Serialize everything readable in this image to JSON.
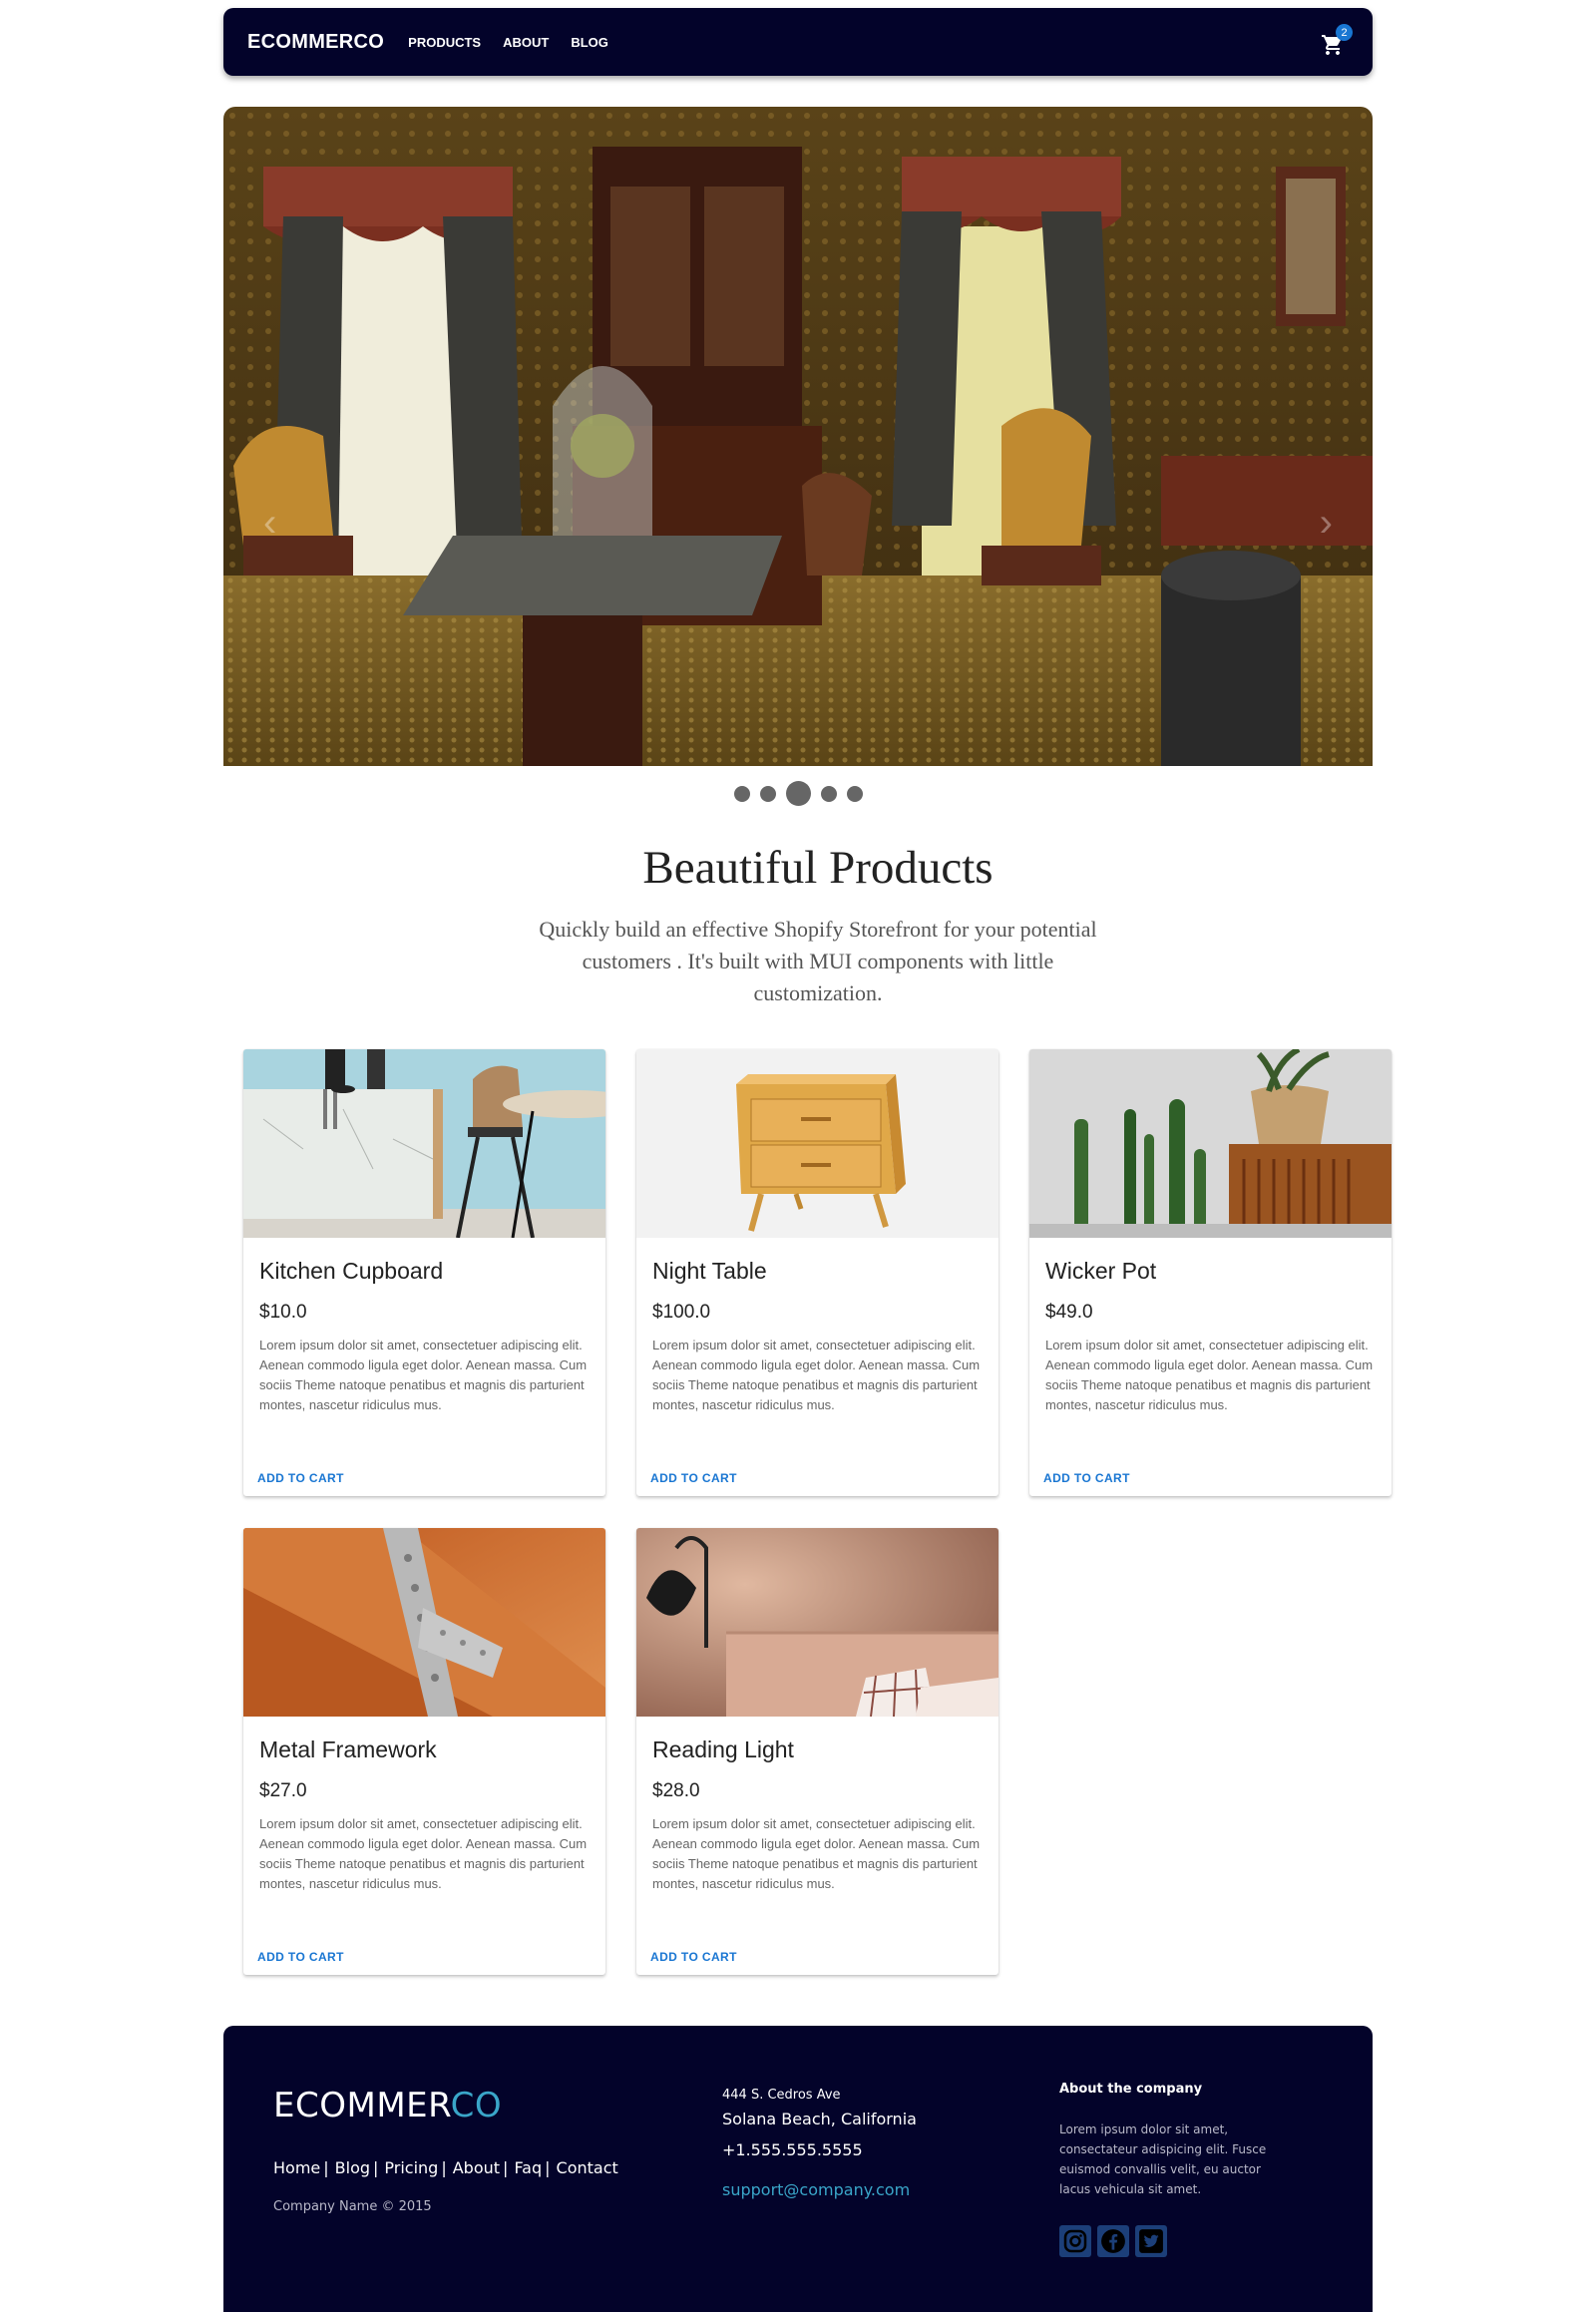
{
  "nav": {
    "brand": "ECOMMERCO",
    "links": [
      "PRODUCTS",
      "ABOUT",
      "BLOG"
    ],
    "cart_count": "2",
    "cart_icon": "shopping-cart-icon"
  },
  "carousel": {
    "slides": 5,
    "active_slide": 3
  },
  "intro": {
    "title": "Beautiful Products",
    "subtitle": "Quickly build an effective Shopify Storefront for your potential customers . It's built with MUI components with little customization."
  },
  "products": [
    {
      "title": "Kitchen Cupboard",
      "price": "$10.0",
      "description": "Lorem ipsum dolor sit amet, consectetuer adipiscing elit. Aenean commodo ligula eget dolor. Aenean massa. Cum sociis Theme natoque penatibus et magnis dis parturient montes, nascetur ridiculus mus.",
      "button": "ADD TO CART"
    },
    {
      "title": "Night Table",
      "price": "$100.0",
      "description": "Lorem ipsum dolor sit amet, consectetuer adipiscing elit. Aenean commodo ligula eget dolor. Aenean massa. Cum sociis Theme natoque penatibus et magnis dis parturient montes, nascetur ridiculus mus.",
      "button": "ADD TO CART"
    },
    {
      "title": "Wicker Pot",
      "price": "$49.0",
      "description": "Lorem ipsum dolor sit amet, consectetuer adipiscing elit. Aenean commodo ligula eget dolor. Aenean massa. Cum sociis Theme natoque penatibus et magnis dis parturient montes, nascetur ridiculus mus.",
      "button": "ADD TO CART"
    },
    {
      "title": "Metal Framework",
      "price": "$27.0",
      "description": "Lorem ipsum dolor sit amet, consectetuer adipiscing elit. Aenean commodo ligula eget dolor. Aenean massa. Cum sociis Theme natoque penatibus et magnis dis parturient montes, nascetur ridiculus mus.",
      "button": "ADD TO CART"
    },
    {
      "title": "Reading Light",
      "price": "$28.0",
      "description": "Lorem ipsum dolor sit amet, consectetuer adipiscing elit. Aenean commodo ligula eget dolor. Aenean massa. Cum sociis Theme natoque penatibus et magnis dis parturient montes, nascetur ridiculus mus.",
      "button": "ADD TO CART"
    }
  ],
  "footer": {
    "logo_main": "ECOMMER",
    "logo_accent": "CO",
    "links": [
      "Home",
      "Blog",
      "Pricing",
      "About",
      "Faq",
      "Contact"
    ],
    "separator": "|",
    "copyright": "Company Name © 2015",
    "address_line1": "444 S. Cedros Ave",
    "address_line2": "Solana Beach, California",
    "phone": "+1.555.555.5555",
    "email": "support@company.com",
    "about_heading": "About the company",
    "about_text": "Lorem ipsum dolor sit amet, consectateur adispicing elit. Fusce euismod convallis velit, eu auctor lacus vehicula sit amet.",
    "social_icons": [
      "instagram-icon",
      "facebook-icon",
      "twitter-icon"
    ]
  },
  "colors": {
    "navy": "#03032a",
    "accent": "#1976d2",
    "teal": "#3aa6c9"
  }
}
